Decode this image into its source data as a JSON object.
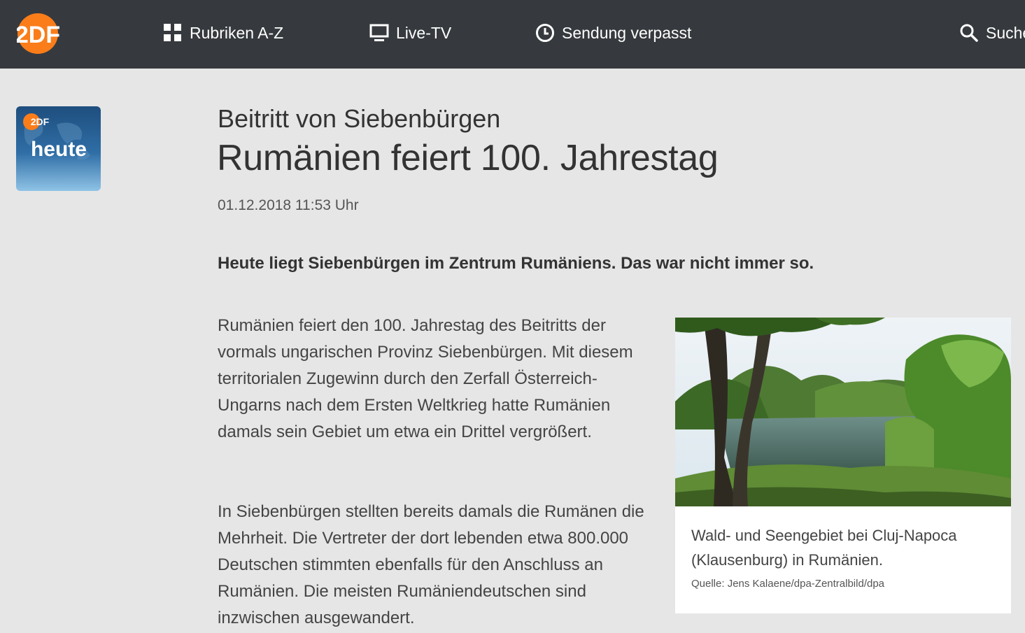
{
  "nav": {
    "rubriken": "Rubriken A-Z",
    "live": "Live-TV",
    "verpasst": "Sendung verpasst",
    "suche": "Suche"
  },
  "logo": {
    "text": "2DF",
    "color": "#fa7d19"
  },
  "badge": {
    "text": "heute",
    "logo": "2DF"
  },
  "article": {
    "kicker": "Beitritt von Siebenbürgen",
    "headline": "Rumänien feiert 100. Jahrestag",
    "date": "01.12.2018 11:53 Uhr",
    "lead": "Heute liegt Siebenbürgen im Zentrum Rumäniens. Das war nicht immer so.",
    "para1": "Rumänien feiert den 100. Jahrestag des Beitritts der vormals ungarischen Provinz Siebenbürgen. Mit diesem territorialen Zugewinn durch den Zerfall Österreich-Ungarns nach dem Ersten Weltkrieg hatte Rumänien damals sein Gebiet um etwa ein Drittel vergrößert.",
    "para2": "In Siebenbürgen stellten bereits damals die Rumänen die Mehrheit. Die Vertreter der dort lebenden etwa 800.000 Deutschen stimmten ebenfalls für den Anschluss an Rumänien. Die meisten Rumäniendeutschen sind inzwischen ausgewandert."
  },
  "figure": {
    "caption": "Wald- und Seengebiet bei Cluj-Napoca (Klausenburg) in Rumänien.",
    "credit": "Quelle: Jens Kalaene/dpa-Zentralbild/dpa"
  },
  "colors": {
    "topbar": "#363a3e",
    "accent": "#fa7d19",
    "background": "#e6e6e6"
  }
}
